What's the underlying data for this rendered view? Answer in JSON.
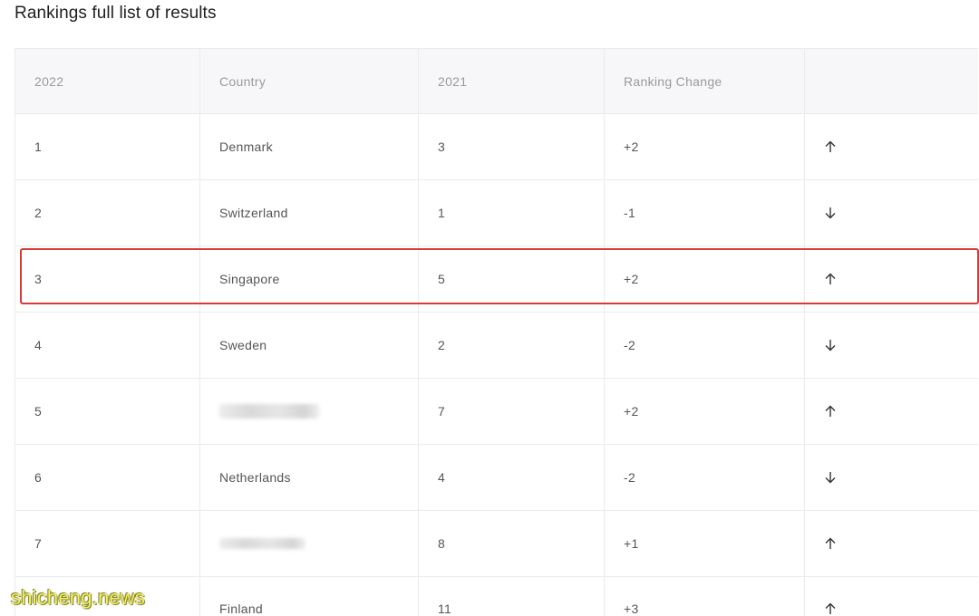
{
  "title": "Rankings full list of results",
  "headers": [
    "2022",
    "Country",
    "2021",
    "Ranking Change",
    ""
  ],
  "rows": [
    {
      "rank2022": "1",
      "country": "Denmark",
      "rank2021": "3",
      "change": "+2",
      "direction": "up"
    },
    {
      "rank2022": "2",
      "country": "Switzerland",
      "rank2021": "1",
      "change": "-1",
      "direction": "down"
    },
    {
      "rank2022": "3",
      "country": "Singapore",
      "rank2021": "5",
      "change": "+2",
      "direction": "up"
    },
    {
      "rank2022": "4",
      "country": "Sweden",
      "rank2021": "2",
      "change": "-2",
      "direction": "down"
    },
    {
      "rank2022": "5",
      "country": "",
      "rank2021": "7",
      "change": "+2",
      "direction": "up"
    },
    {
      "rank2022": "6",
      "country": "Netherlands",
      "rank2021": "4",
      "change": "-2",
      "direction": "down"
    },
    {
      "rank2022": "7",
      "country": "",
      "rank2021": "8",
      "change": "+1",
      "direction": "up"
    },
    {
      "rank2022": "8",
      "country": "Finland",
      "rank2021": "11",
      "change": "+3",
      "direction": "up"
    }
  ],
  "highlight_color": "#d93a3a",
  "watermark": "shicheng.news",
  "icons": {
    "up": "arrow-up-icon",
    "down": "arrow-down-icon"
  }
}
